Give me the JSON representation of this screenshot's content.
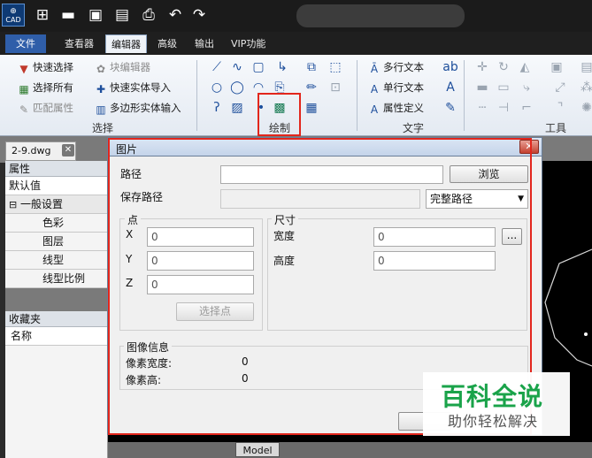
{
  "app": {
    "logo_text": "CAD",
    "quick_access": [
      "new-file-icon",
      "open-folder-icon",
      "save-icon",
      "save-as-icon",
      "print-icon",
      "undo-icon",
      "redo-icon"
    ]
  },
  "tabs": [
    "文件",
    "查看器",
    "编辑器",
    "高级",
    "输出",
    "VIP功能"
  ],
  "active_tab": "编辑器",
  "ribbon": {
    "select_group": {
      "label": "选择",
      "items": [
        "快速选择",
        "选择所有",
        "匹配属性"
      ],
      "items2": [
        "块编辑器",
        "快速实体导入",
        "多边形实体输入"
      ]
    },
    "draw_group": {
      "label": "绘制"
    },
    "text_group": {
      "label": "文字",
      "items": [
        "多行文本",
        "单行文本",
        "属性定义"
      ]
    },
    "tools_group": {
      "label": "工具"
    }
  },
  "document_tab": "2-9.dwg",
  "left_panel": {
    "properties_header": "属性",
    "default_value": "默认值",
    "general_section": "一般设置",
    "rows": [
      "色彩",
      "图层",
      "线型",
      "线型比例"
    ],
    "favorites_header": "收藏夹",
    "name_column": "名称"
  },
  "dialog": {
    "title": "图片",
    "path_label": "路径",
    "path_value": "",
    "browse_label": "浏览",
    "save_path_label": "保存路径",
    "save_path_option": "完整路径",
    "point_group": "点",
    "x_label": "X",
    "x_value": "0",
    "y_label": "Y",
    "y_value": "0",
    "z_label": "Z",
    "z_value": "0",
    "select_point_label": "选择点",
    "size_group": "尺寸",
    "width_label": "宽度",
    "width_value": "0",
    "height_label": "高度",
    "height_value": "0",
    "ellipsis_label": "...",
    "image_info_group": "图像信息",
    "pixel_width_label": "像素宽度:",
    "pixel_width_value": "0",
    "pixel_height_label": "像素高:",
    "pixel_height_value": "0"
  },
  "model_tab": "Model",
  "watermark": {
    "line1": "百科全说",
    "line2": "助你轻松解决"
  },
  "colors": {
    "highlight": "#e2261c",
    "file_tab": "#2f5ea9",
    "watermark_green": "#1aa34a"
  }
}
